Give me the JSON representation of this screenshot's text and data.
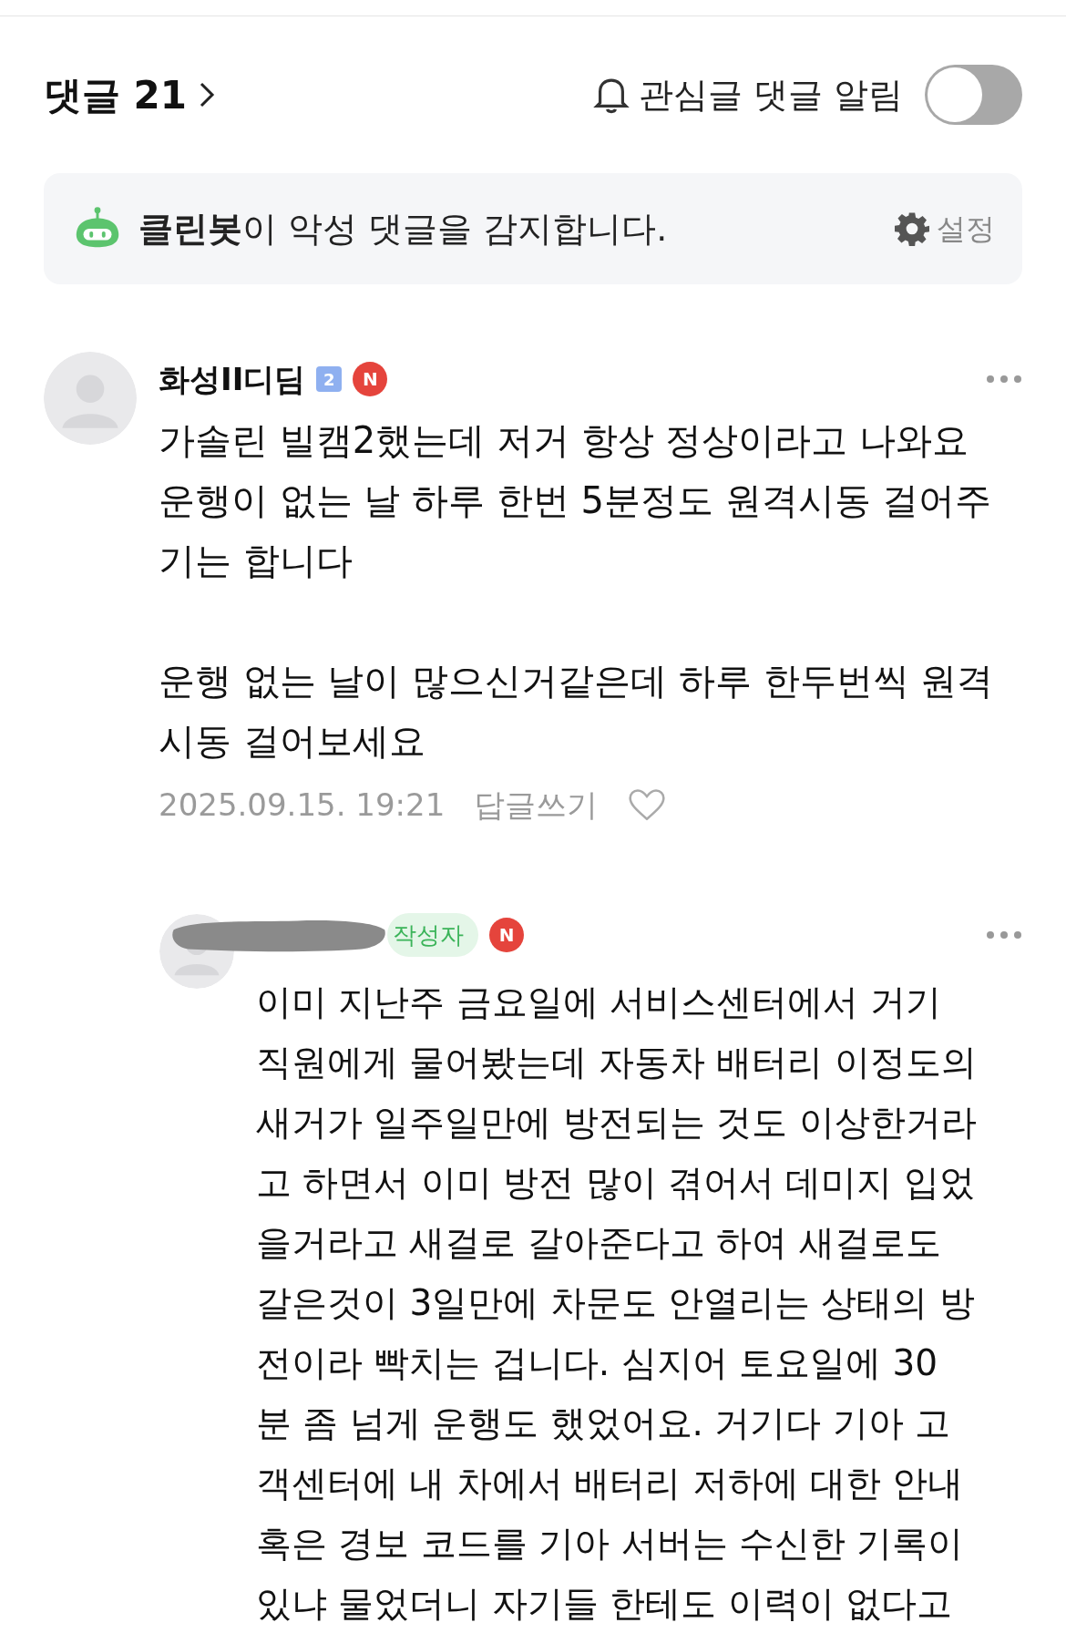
{
  "header": {
    "title": "댓글 21",
    "watch_label": "관심글 댓글 알림",
    "watch_on": false
  },
  "cleanbot": {
    "message": "**클린봇**이 악성 댓글을 감지합니다.",
    "settings": "설정"
  },
  "comments": [
    {
      "author": "화성II디딤",
      "level_badge": "2",
      "author_redacted": false,
      "new_badge": "N",
      "reply": false,
      "paragraphs": [
        [
          "가솔린 빌캠2했는데 저거 항상 정상이라고 나와요",
          "운행이 없는 날 하루 한번 5분정도 원격시동 걸어주",
          "기는 합니다"
        ],
        [
          "운행 없는 날이 많으신거같은데 하루 한두번씩 원격",
          "시동 걸어보세요"
        ]
      ],
      "date": "2025.09.15. 19:21",
      "reply_label": "답글쓰기",
      "liked": false
    },
    {
      "author_redacted": true,
      "writer_badge": "작성자",
      "new_badge": "N",
      "reply": true,
      "paragraphs": [
        [
          "이미 지난주 금요일에 서비스센터에서 거기",
          "직원에게 물어봤는데 자동차 배터리 이정도의",
          "새거가 일주일만에 방전되는 것도 이상한거라",
          "고 하면서 이미 방전 많이 겪어서 데미지 입었",
          "을거라고 새걸로 갈아준다고 하여 새걸로도",
          "갈은것이 3일만에 차문도 안열리는 상태의 방",
          "전이라 빡치는 겁니다. 심지어 토요일에 30",
          "분 좀 넘게 운행도 했었어요. 거기다 기아 고",
          "객센터에 내 차에서 배터리 저하에 대한 안내",
          "혹은 경보 코드를 기아 서버는 수신한 기록이",
          "있냐 물었더니 자기들 한테도 이력이 없다고"
        ]
      ]
    }
  ]
}
